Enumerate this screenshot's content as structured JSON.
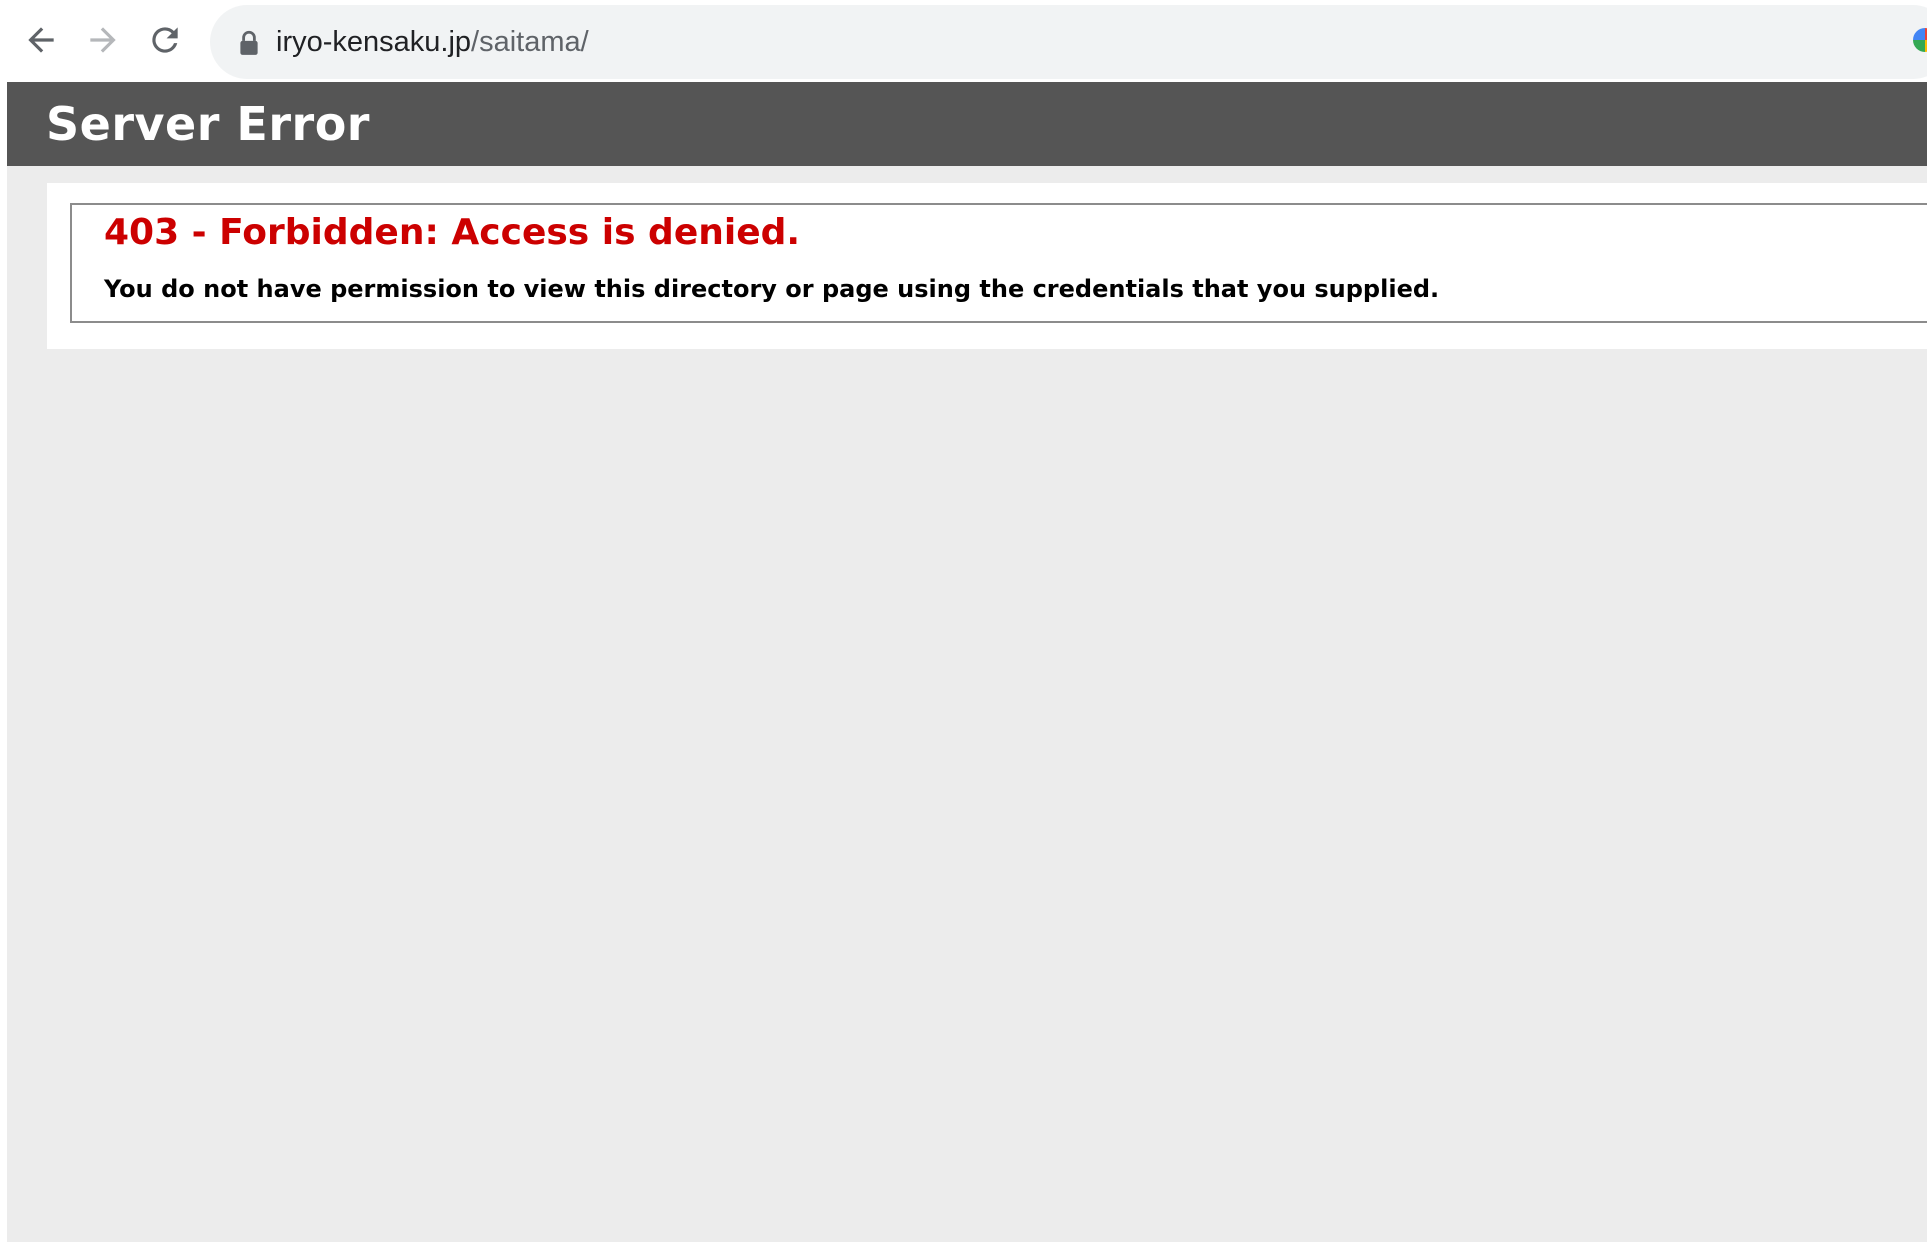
{
  "browser": {
    "url_host": "iryo-kensaku.jp",
    "url_path": "/saitama/",
    "icons": {
      "back": "arrow-left-icon",
      "forward": "arrow-right-icon",
      "reload": "reload-icon",
      "secure": "lock-icon",
      "extension": "google-icon"
    }
  },
  "page": {
    "header_title": "Server Error",
    "error_heading": "403 - Forbidden: Access is denied.",
    "error_message": "You do not have permission to view this directory or page using the credentials that you supplied."
  },
  "colors": {
    "header_bg": "#555555",
    "page_bg": "#ececec",
    "error_red": "#cc0000"
  }
}
